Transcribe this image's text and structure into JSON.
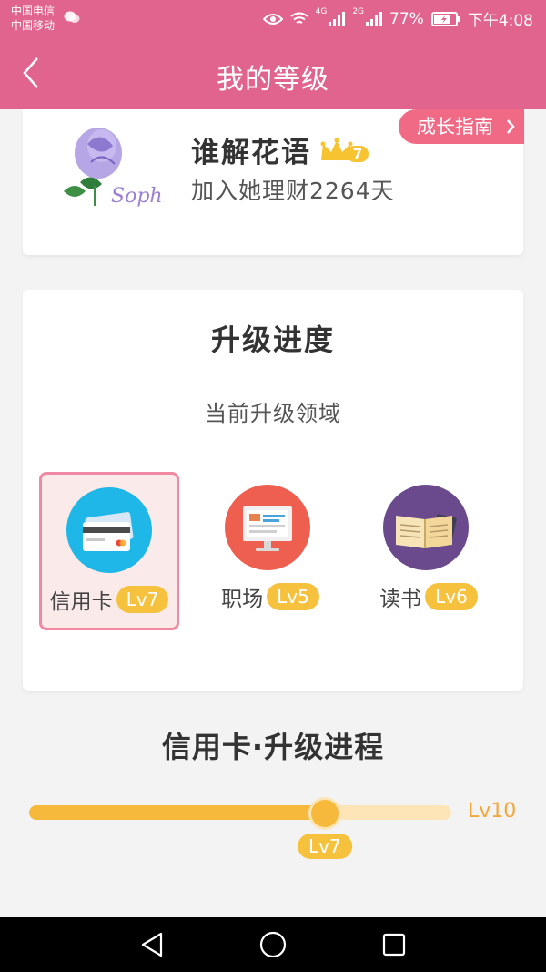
{
  "status_bar": {
    "carrier_1": "中国电信",
    "carrier_2": "中国移动",
    "network_1": "4G",
    "network_2": "2G",
    "battery": "77%",
    "time": "下午4:08"
  },
  "nav": {
    "title": "我的等级",
    "back_icon": "chevron-left-icon"
  },
  "profile": {
    "avatar_signature": "Sophia",
    "username": "谁解花语",
    "crown_level": "7",
    "join_text": "加入她理财2264天",
    "guide_button": "成长指南"
  },
  "upgrade": {
    "title": "升级进度",
    "subtitle": "当前升级领域",
    "domains": [
      {
        "name": "信用卡",
        "level": "Lv7",
        "icon": "credit-card-icon",
        "selected": true
      },
      {
        "name": "职场",
        "level": "Lv5",
        "icon": "monitor-icon",
        "selected": false
      },
      {
        "name": "读书",
        "level": "Lv6",
        "icon": "book-icon",
        "selected": false
      }
    ]
  },
  "process": {
    "title": "信用卡·升级进程",
    "current_level": "Lv7",
    "max_level": "Lv10",
    "progress": 0.7
  },
  "colors": {
    "brand_pink": "#e1648e",
    "guide_pink": "#f06a86",
    "level_yellow": "#f6c23e",
    "track_light": "#fde5b8"
  }
}
